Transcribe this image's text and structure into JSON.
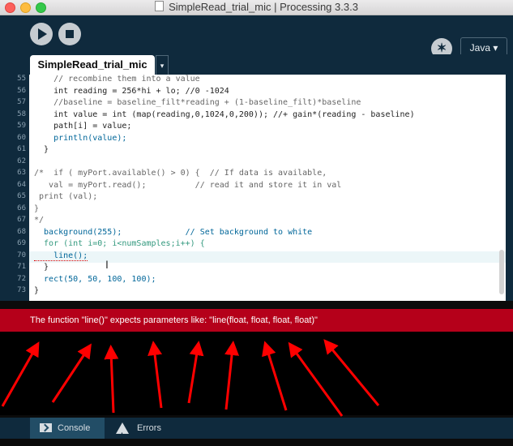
{
  "window": {
    "title": "SimpleRead_trial_mic | Processing 3.3.3"
  },
  "toolbar": {
    "mode": "Java ▾",
    "debug_icon": "butterfly-icon"
  },
  "tab": {
    "name": "SimpleRead_trial_mic",
    "menu": "▾"
  },
  "editor": {
    "lines": [
      {
        "num": "55",
        "text": "    // recombine them into a value"
      },
      {
        "num": "56",
        "text": "    int reading = 256*hi + lo; //0 -1024"
      },
      {
        "num": "57",
        "text": "    //baseline = baseline_filt*reading + (1-baseline_filt)*baseline"
      },
      {
        "num": "58",
        "text": "    int value = int (map(reading,0,1024,0,200)); //+ gain*(reading - baseline)"
      },
      {
        "num": "59",
        "text": "    path[i] = value;"
      },
      {
        "num": "60",
        "text": "    println(value);"
      },
      {
        "num": "61",
        "text": "  }"
      },
      {
        "num": "62",
        "text": ""
      },
      {
        "num": "63",
        "text": "/*  if ( myPort.available() > 0) {  // If data is available,"
      },
      {
        "num": "64",
        "text": "   val = myPort.read();          // read it and store it in val"
      },
      {
        "num": "65",
        "text": " print (val);"
      },
      {
        "num": "66",
        "text": "}"
      },
      {
        "num": "67",
        "text": "*/"
      },
      {
        "num": "68",
        "text": "  background(255);             // Set background to white"
      },
      {
        "num": "69",
        "text": "  for (int i=0; i<numSamples;i++) {"
      },
      {
        "num": "70",
        "text": "    line();"
      },
      {
        "num": "71",
        "text": "  }"
      },
      {
        "num": "72",
        "text": "  rect(50, 50, 100, 100);"
      },
      {
        "num": "73",
        "text": "}"
      }
    ]
  },
  "status": {
    "message": "The function \"line()\" expects parameters like: \"line(float, float, float, float)\""
  },
  "bottom_tabs": {
    "console": "Console",
    "errors": "Errors"
  },
  "colors": {
    "toolbar": "#0f2a3d",
    "error_bar": "#b5001a",
    "arrows": "#ff0000"
  }
}
